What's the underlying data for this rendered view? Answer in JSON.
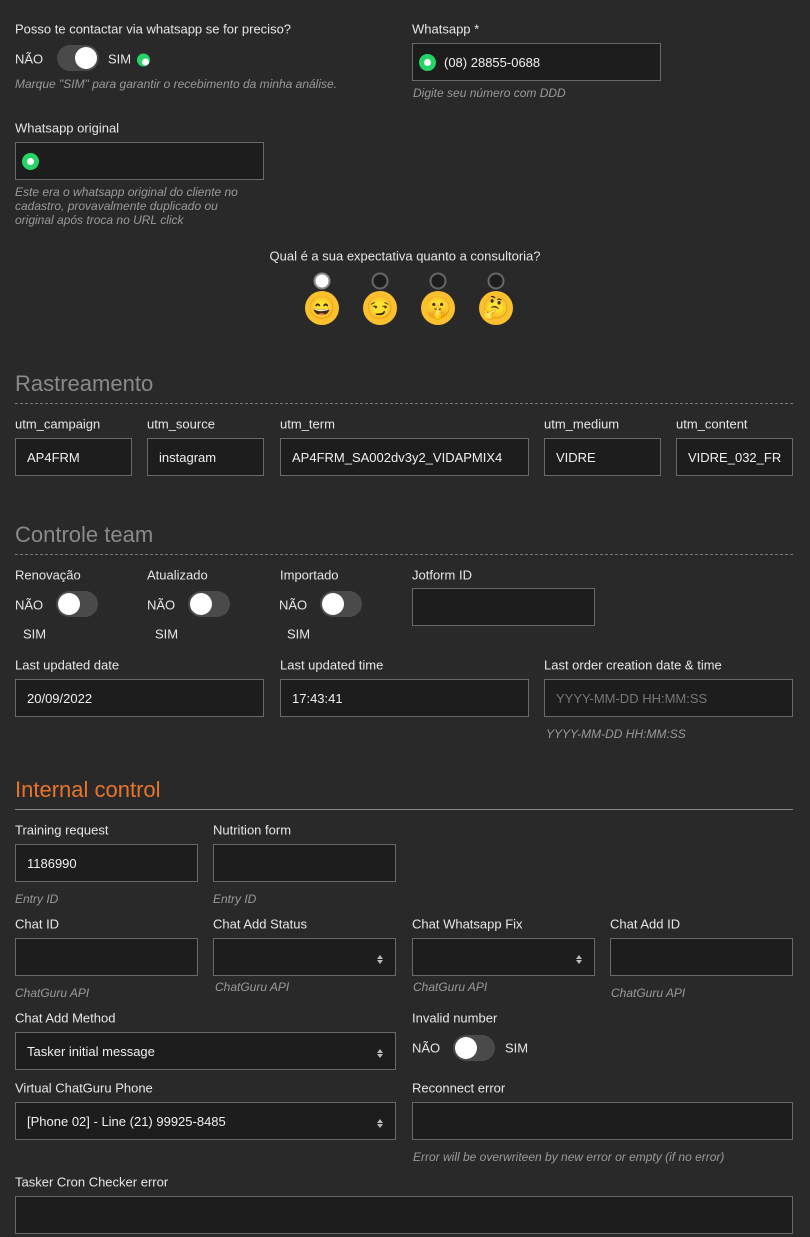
{
  "contact": {
    "question": "Posso te contactar via whatsapp se for preciso?",
    "no": "NÃO",
    "yes": "SIM",
    "state": "on",
    "help": "Marque \"SIM\" para garantir o recebimento da minha análise."
  },
  "whatsapp": {
    "label": "Whatsapp *",
    "value": "(08) 28855-0688",
    "help": "Digite seu número com DDD"
  },
  "whatsapp_original": {
    "label": "Whatsapp original",
    "value": "",
    "help": [
      "Este era o whatsapp original do cliente no",
      "cadastro, provavalmente duplicado ou",
      "original após troca no URL click"
    ]
  },
  "expectation": {
    "question": "Qual é a sua expectativa quanto a consultoria?",
    "options": [
      "😄",
      "😏",
      "🤫",
      "🤔"
    ],
    "selected": 0
  },
  "tracking": {
    "title": "Rastreamento",
    "fields": [
      {
        "label": "utm_campaign",
        "value": "AP4FRM"
      },
      {
        "label": "utm_source",
        "value": "instagram"
      },
      {
        "label": "utm_term",
        "value": "AP4FRM_SA002dv3y2_VIDAPMIX4"
      },
      {
        "label": "utm_medium",
        "value": "VIDRE"
      },
      {
        "label": "utm_content",
        "value": "VIDRE_032_FR"
      }
    ]
  },
  "team": {
    "title": "Controle team",
    "toggles": [
      {
        "label": "Renovação",
        "no": "NÃO",
        "yes": "SIM",
        "state": "off"
      },
      {
        "label": "Atualizado",
        "no": "NÃO",
        "yes": "SIM",
        "state": "off"
      },
      {
        "label": "Importado",
        "no": "NÃO",
        "yes": "SIM",
        "state": "off"
      }
    ],
    "jotform": {
      "label": "Jotform ID",
      "value": ""
    },
    "last_date": {
      "label": "Last updated date",
      "value": "20/09/2022"
    },
    "last_time": {
      "label": "Last updated time",
      "value": "17:43:41"
    },
    "last_order": {
      "label": "Last order creation date & time",
      "placeholder": "YYYY-MM-DD HH:MM:SS",
      "help": "YYYY-MM-DD HH:MM:SS"
    }
  },
  "internal": {
    "title": "Internal control",
    "accent": "#e8742c",
    "training": {
      "label": "Training request",
      "value": "1186990",
      "help": "Entry ID"
    },
    "nutrition": {
      "label": "Nutrition form",
      "value": "",
      "help": "Entry ID"
    },
    "chat_id": {
      "label": "Chat ID",
      "value": "",
      "help": "ChatGuru API"
    },
    "chat_add_status": {
      "label": "Chat Add Status",
      "value": "",
      "help": "ChatGuru API"
    },
    "chat_whatsapp_fix": {
      "label": "Chat Whatsapp Fix",
      "value": "",
      "help": "ChatGuru API"
    },
    "chat_add_id": {
      "label": "Chat Add ID",
      "value": "",
      "help": "ChatGuru API"
    },
    "chat_add_method": {
      "label": "Chat Add Method",
      "value": "Tasker initial message"
    },
    "invalid_number": {
      "label": "Invalid number",
      "no": "NÃO",
      "yes": "SIM",
      "state": "off"
    },
    "virtual_phone": {
      "label": "Virtual ChatGuru Phone",
      "value": "[Phone 02] - Line (21) 99925-8485"
    },
    "reconnect_error": {
      "label": "Reconnect error",
      "value": "",
      "help": "Error will be overwriteen by new error or empty (if no error)"
    },
    "tasker_error": {
      "label": "Tasker Cron Checker error",
      "value": ""
    }
  }
}
